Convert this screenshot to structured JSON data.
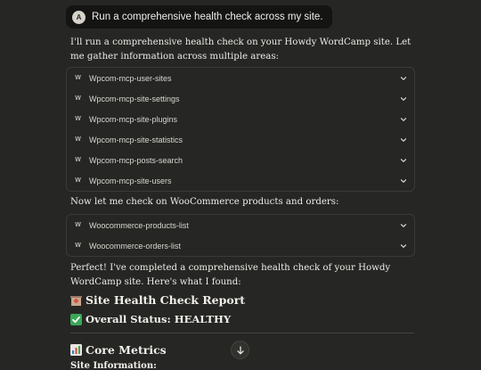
{
  "user_message": {
    "avatar_initial": "A",
    "text": "Run a comprehensive health check across my site."
  },
  "intro_text": "I'll run a comprehensive health check on your Howdy WordCamp site. Let me gather information across multiple areas:",
  "tool_group_1": [
    {
      "icon": "W",
      "label": "Wpcom-mcp-user-sites"
    },
    {
      "icon": "W",
      "label": "Wpcom-mcp-site-settings"
    },
    {
      "icon": "W",
      "label": "Wpcom-mcp-site-plugins"
    },
    {
      "icon": "W",
      "label": "Wpcom-mcp-site-statistics"
    },
    {
      "icon": "W",
      "label": "Wpcom-mcp-posts-search"
    },
    {
      "icon": "W",
      "label": "Wpcom-mcp-site-users"
    }
  ],
  "woo_text": "Now let me check on WooCommerce products and orders:",
  "tool_group_2": [
    {
      "icon": "W",
      "label": "Woocommerce-products-list"
    },
    {
      "icon": "W",
      "label": "Woocommerce-orders-list"
    }
  ],
  "summary_text": "Perfect! I've completed a comprehensive health check of your Howdy WordCamp site. Here's what I found:",
  "report_heading": {
    "emoji": "hospital-emoji",
    "text": "Site Health Check Report"
  },
  "status_heading": {
    "emoji": "check-mark-emoji",
    "text": "Overall Status: HEALTHY"
  },
  "metrics_heading": {
    "emoji": "bar-chart-emoji",
    "text": "Core Metrics"
  },
  "site_info_label": "Site Information:",
  "colors": {
    "background": "#262624",
    "user_bubble": "#141413",
    "check_green": "#3aa757"
  }
}
